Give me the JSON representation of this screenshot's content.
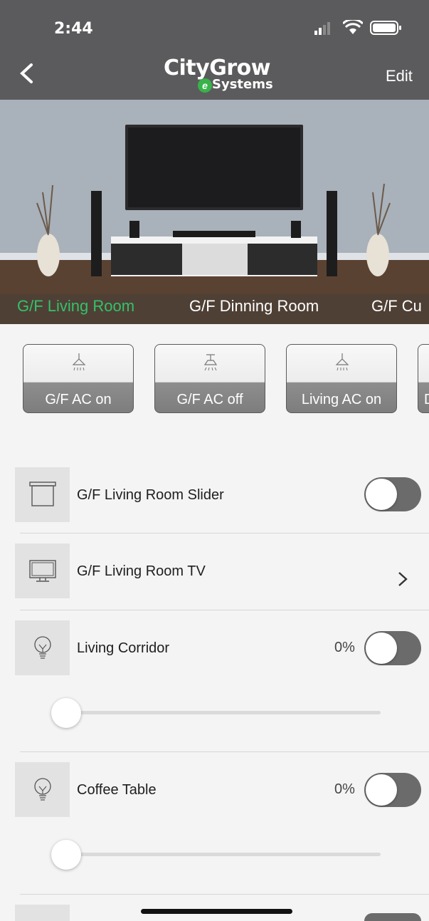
{
  "status_bar": {
    "time": "2:44"
  },
  "header": {
    "logo_line1": "CityGrow",
    "logo_e": "e",
    "logo_line2": "Systems",
    "edit_label": "Edit"
  },
  "rooms": [
    {
      "label": "G/F Living Room",
      "active": true
    },
    {
      "label": "G/F Dinning Room",
      "active": false
    },
    {
      "label": "G/F Cu",
      "active": false
    }
  ],
  "scenes": [
    {
      "label": "G/F AC on"
    },
    {
      "label": "G/F AC off"
    },
    {
      "label": "Living AC on"
    },
    {
      "label": "D"
    }
  ],
  "devices": [
    {
      "name": "G/F Living Room Slider",
      "icon": "curtain-icon",
      "control": "toggle",
      "on": false
    },
    {
      "name": "G/F Living Room TV",
      "icon": "tv-icon",
      "control": "chevron",
      "chevron": ">"
    },
    {
      "name": "Living Corridor",
      "icon": "bulb-icon",
      "control": "dimmer",
      "level": "0%",
      "on": false
    },
    {
      "name": "Coffee Table",
      "icon": "bulb-icon",
      "control": "dimmer",
      "level": "0%",
      "on": false
    }
  ],
  "colors": {
    "header": "#5b5b5d",
    "active_tab": "#33c26a",
    "toggle_off": "#6b6b6b"
  }
}
